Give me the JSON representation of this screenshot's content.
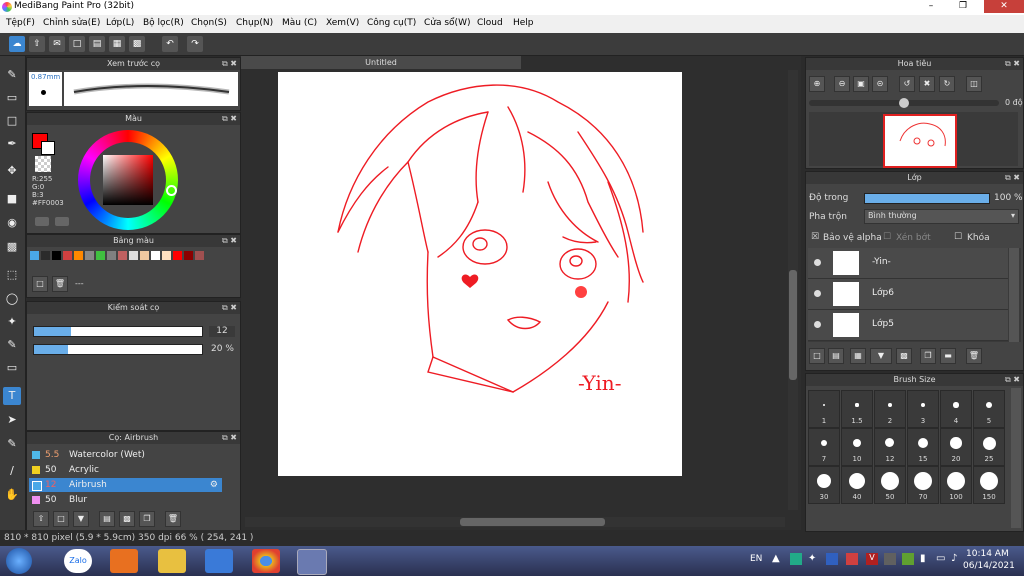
{
  "window": {
    "title": "MediBang Paint Pro (32bit)"
  },
  "menu": [
    "Tệp(F)",
    "Chỉnh sửa(E)",
    "Lớp(L)",
    "Bộ lọc(R)",
    "Chọn(S)",
    "Chụp(N)",
    "Màu (C)",
    "Xem(V)",
    "Công cụ(T)",
    "Cửa sổ(W)",
    "Cloud",
    "Help"
  ],
  "brush_preview": {
    "title": "Xem trước cọ",
    "size": "0.87mm"
  },
  "color": {
    "title": "Màu",
    "r": "R:255",
    "g": "G:0",
    "b": "B:3",
    "hex": "#FF0003",
    "primary": "#ff0003"
  },
  "palette": {
    "title": "Bảng màu",
    "swatches": [
      "#4aa8e8",
      "#2b2b2b",
      "#000000",
      "#d04040",
      "#ff8800",
      "#888888",
      "#40c040",
      "#808080",
      "#c06060",
      "#dddddd",
      "#f0c8a0",
      "#ffffff",
      "#ffe0c0",
      "#ff0000",
      "#8b0000",
      "#a05050"
    ],
    "more": "---"
  },
  "brush_control": {
    "title": "Kiểm soát cọ",
    "size_value": "12",
    "size_fraction": 0.22,
    "opacity_value": "20 %",
    "opacity_fraction": 0.2
  },
  "brushes": {
    "title": "Cọ: Airbrush",
    "items": [
      {
        "num": "5.5",
        "name": "Watercolor (Wet)",
        "color": "#4fb8e8"
      },
      {
        "num": "50",
        "name": "Acrylic",
        "color": "#f0d020"
      },
      {
        "num": "12",
        "name": "Airbrush",
        "color": "#4aa8e8"
      },
      {
        "num": "50",
        "name": "Blur",
        "color": "#f090f0"
      }
    ]
  },
  "document": {
    "tab": "Untitled",
    "signature": "-Yin-"
  },
  "navigator": {
    "title": "Hoa tiêu",
    "zoom_label": "0 độ"
  },
  "layers": {
    "title": "Lớp",
    "opacity_label": "Độ trong",
    "opacity_value": "100 %",
    "opacity_fraction": 1.0,
    "blend_label": "Pha trộn",
    "blend_value": "Bình thường",
    "protect_alpha": "Bảo vệ alpha",
    "clipping": "Xén bớt",
    "lock": "Khóa",
    "items": [
      {
        "name": "-Yin-"
      },
      {
        "name": "Lớp6"
      },
      {
        "name": "Lớp5"
      }
    ]
  },
  "brush_size": {
    "title": "Brush Size",
    "sizes": [
      "1",
      "1.5",
      "2",
      "3",
      "4",
      "5",
      "7",
      "10",
      "12",
      "15",
      "20",
      "25",
      "30",
      "40",
      "50",
      "70",
      "100",
      "150"
    ]
  },
  "status": {
    "text": "810 * 810 pixel   (5.9 * 5.9cm)   350 dpi   66 %   ( 254, 241 )"
  },
  "taskbar": {
    "lang": "EN",
    "time": "10:14 AM",
    "date": "06/14/2021",
    "zalo": "Zalo"
  }
}
